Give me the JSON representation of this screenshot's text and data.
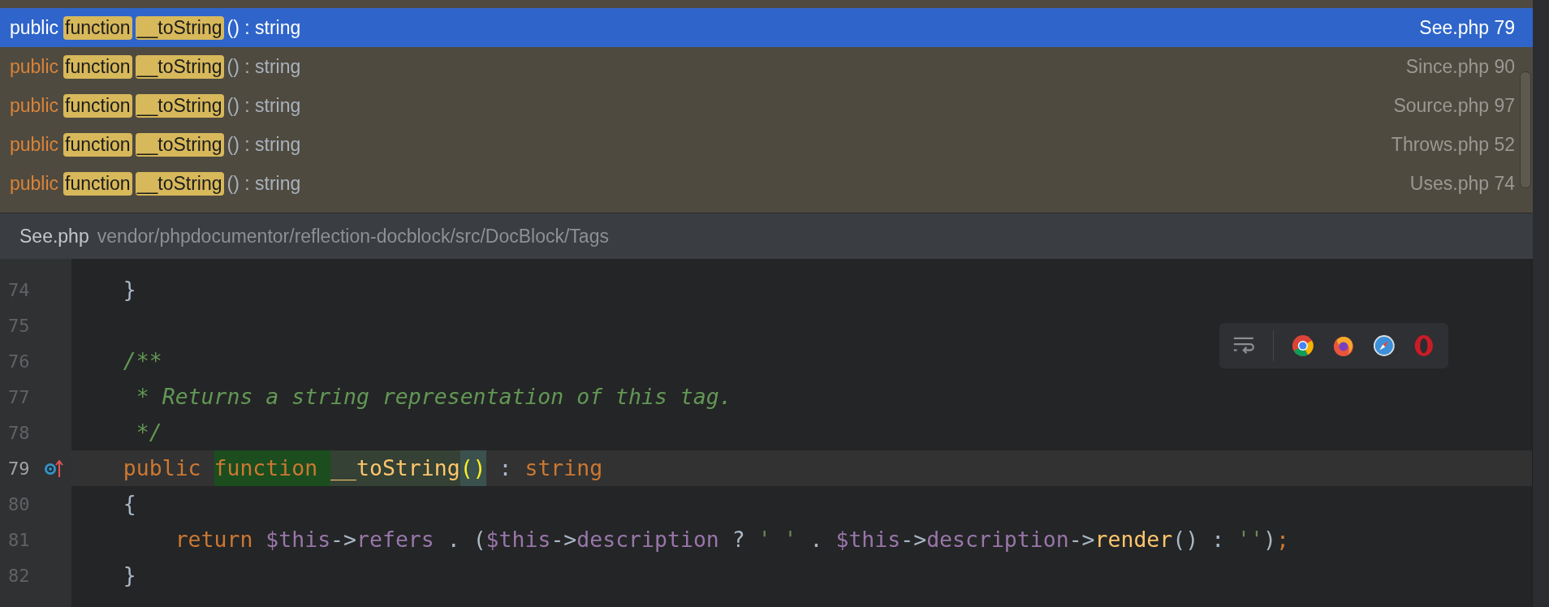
{
  "popup": {
    "results": [
      {
        "selected": true,
        "signature": [
          {
            "text": "public",
            "kind": "keyword"
          },
          {
            "text": "function",
            "kind": "match"
          },
          {
            "text": "__toString",
            "kind": "match"
          },
          {
            "text": "() : string",
            "kind": "plain"
          }
        ],
        "location": "See.php 79"
      },
      {
        "selected": false,
        "signature": [
          {
            "text": "public",
            "kind": "keyword"
          },
          {
            "text": "function",
            "kind": "match"
          },
          {
            "text": "__toString",
            "kind": "match"
          },
          {
            "text": "() : string",
            "kind": "plain"
          }
        ],
        "location": "Since.php 90"
      },
      {
        "selected": false,
        "signature": [
          {
            "text": "public",
            "kind": "keyword"
          },
          {
            "text": "function",
            "kind": "match"
          },
          {
            "text": "__toString",
            "kind": "match"
          },
          {
            "text": "() : string",
            "kind": "plain"
          }
        ],
        "location": "Source.php 97"
      },
      {
        "selected": false,
        "signature": [
          {
            "text": "public",
            "kind": "keyword"
          },
          {
            "text": "function",
            "kind": "match"
          },
          {
            "text": "__toString",
            "kind": "match"
          },
          {
            "text": "() : string",
            "kind": "plain"
          }
        ],
        "location": "Throws.php 52"
      },
      {
        "selected": false,
        "signature": [
          {
            "text": "public",
            "kind": "keyword"
          },
          {
            "text": "function",
            "kind": "match"
          },
          {
            "text": "__toString",
            "kind": "match"
          },
          {
            "text": "() : string",
            "kind": "plain"
          }
        ],
        "location": "Uses.php 74"
      }
    ],
    "footer": {
      "file": "See.php",
      "path": "vendor/phpdocumentor/reflection-docblock/src/DocBlock/Tags"
    }
  },
  "editor": {
    "lines": [
      {
        "number": "74",
        "current": false,
        "tokens": [
          {
            "text": "    }",
            "kind": "plain"
          }
        ]
      },
      {
        "number": "75",
        "current": false
      },
      {
        "number": "76",
        "current": false,
        "tokens": [
          {
            "text": "    /**",
            "kind": "comment"
          }
        ]
      },
      {
        "number": "77",
        "current": false,
        "tokens": [
          {
            "text": "     * Returns a string representation of this tag.",
            "kind": "comment"
          }
        ]
      },
      {
        "number": "78",
        "current": false,
        "tokens": [
          {
            "text": "     */",
            "kind": "comment"
          }
        ]
      },
      {
        "number": "79",
        "current": true,
        "overridden": true,
        "tokens": [
          {
            "text": "    public ",
            "kind": "keyword"
          },
          {
            "text": "function ",
            "kind": "keyword",
            "highlighted": true
          },
          {
            "text": "__toString",
            "kind": "funcname",
            "highlighted": true
          },
          {
            "text": "()",
            "kind": "brace",
            "highlighted": true
          },
          {
            "text": " : ",
            "kind": "plain"
          },
          {
            "text": "string",
            "kind": "keyword"
          }
        ]
      },
      {
        "number": "80",
        "current": false,
        "tokens": [
          {
            "text": "    {",
            "kind": "plain"
          }
        ]
      },
      {
        "number": "81",
        "current": false,
        "tokens": [
          {
            "text": "        return ",
            "kind": "keyword"
          },
          {
            "text": "$this",
            "kind": "var"
          },
          {
            "text": "->",
            "kind": "plain"
          },
          {
            "text": "refers",
            "kind": "field"
          },
          {
            "text": " . (",
            "kind": "plain"
          },
          {
            "text": "$this",
            "kind": "var"
          },
          {
            "text": "->",
            "kind": "plain"
          },
          {
            "text": "description",
            "kind": "field"
          },
          {
            "text": " ? ",
            "kind": "plain"
          },
          {
            "text": "' '",
            "kind": "string"
          },
          {
            "text": " . ",
            "kind": "plain"
          },
          {
            "text": "$this",
            "kind": "var"
          },
          {
            "text": "->",
            "kind": "plain"
          },
          {
            "text": "description",
            "kind": "field"
          },
          {
            "text": "->",
            "kind": "plain"
          },
          {
            "text": "render",
            "kind": "method"
          },
          {
            "text": "() : ",
            "kind": "plain"
          },
          {
            "text": "''",
            "kind": "string"
          },
          {
            "text": ")",
            "kind": "plain"
          },
          {
            "text": ";",
            "kind": "keyword"
          }
        ]
      },
      {
        "number": "82",
        "current": false,
        "tokens": [
          {
            "text": "    }",
            "kind": "plain"
          }
        ]
      }
    ]
  }
}
